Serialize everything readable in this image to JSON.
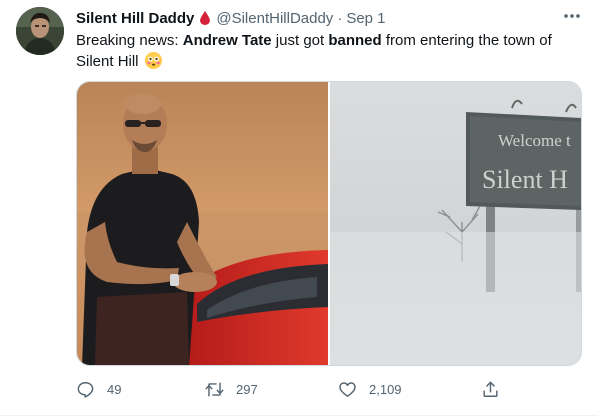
{
  "tweet": {
    "display_name": "Silent Hill Daddy",
    "handle": "@SilentHillDaddy",
    "separator": "·",
    "date": "Sep 1",
    "text_parts": [
      "Breaking news: ",
      "Andrew Tate",
      " just got ",
      "banned",
      " from entering the town of Silent Hill"
    ],
    "media": {
      "left_image": "man-in-black-shirt-beside-red-car",
      "right_image": "foggy-welcome-to-silent-hill-sign",
      "sign_line1": "Welcome t",
      "sign_line2": "Silent H"
    },
    "actions": {
      "replies": "49",
      "retweets": "297",
      "likes": "2,109"
    }
  },
  "icons": {
    "more": "more-dots-icon",
    "reply": "reply-bubble-icon",
    "retweet": "retweet-arrows-icon",
    "like": "heart-icon",
    "share": "share-upload-icon",
    "badge": "blood-drop-icon",
    "emoji": "flushed-face-emoji"
  },
  "colors": {
    "text": "#0f1419",
    "secondary": "#536471",
    "drop": "#d6213b",
    "border": "#cfd9de"
  }
}
